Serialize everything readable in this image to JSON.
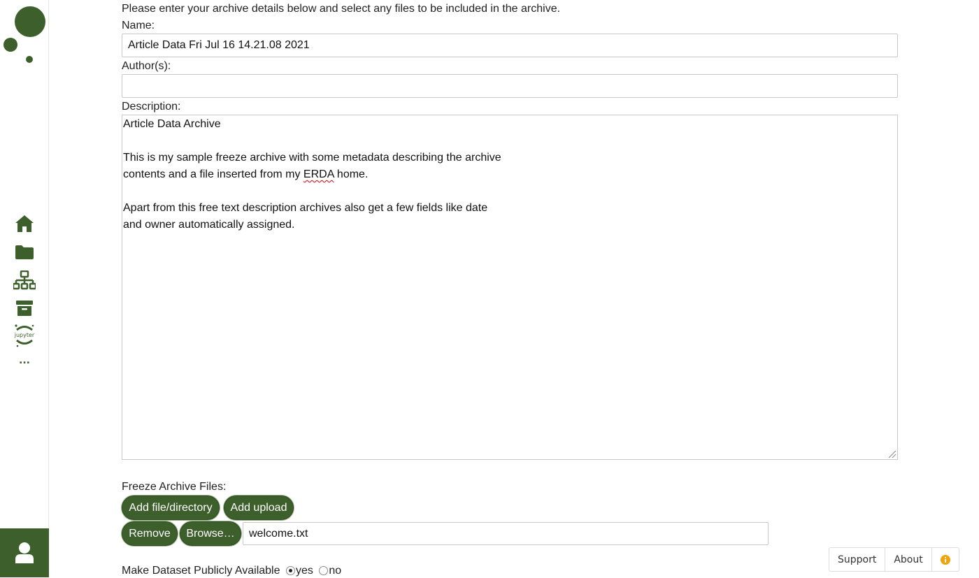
{
  "sidebar": {
    "nav_items": [
      {
        "icon": "home-icon"
      },
      {
        "icon": "folder-icon"
      },
      {
        "icon": "network-icon"
      },
      {
        "icon": "archive-icon"
      },
      {
        "icon": "jupyter-icon",
        "label": "jupyter"
      },
      {
        "icon": "more-icon",
        "label": "..."
      }
    ],
    "user_icon": "user-icon"
  },
  "form": {
    "intro": "Please enter your archive details below and select any files to be included in the archive.",
    "name_label": "Name:",
    "name_value": "Article Data Fri Jul 16 14.21.08 2021",
    "authors_label": "Author(s):",
    "authors_value": "",
    "description_label": "Description:",
    "description_lines": [
      "Article Data Archive",
      "",
      "This is my sample freeze archive with some metadata describing the archive",
      "contents and a file inserted from my ",
      "",
      "Apart from this free text description archives also get a few fields like date",
      "and owner automatically assigned."
    ],
    "description_spell_word": "ERDA",
    "description_after_word": " home.",
    "files_label": "Freeze Archive Files:",
    "add_file_button": "Add file/directory",
    "add_upload_button": "Add upload",
    "remove_button": "Remove",
    "browse_button": "Browse…",
    "file_value": "welcome.txt",
    "public_label": "Make Dataset Publicly Available",
    "public_options": {
      "yes": "yes",
      "no": "no"
    },
    "public_selected": "yes"
  },
  "footer": {
    "support": "Support",
    "about": "About",
    "info_icon": "info-icon"
  },
  "colors": {
    "accent": "#3d5f2c",
    "info": "#f0a30a"
  }
}
